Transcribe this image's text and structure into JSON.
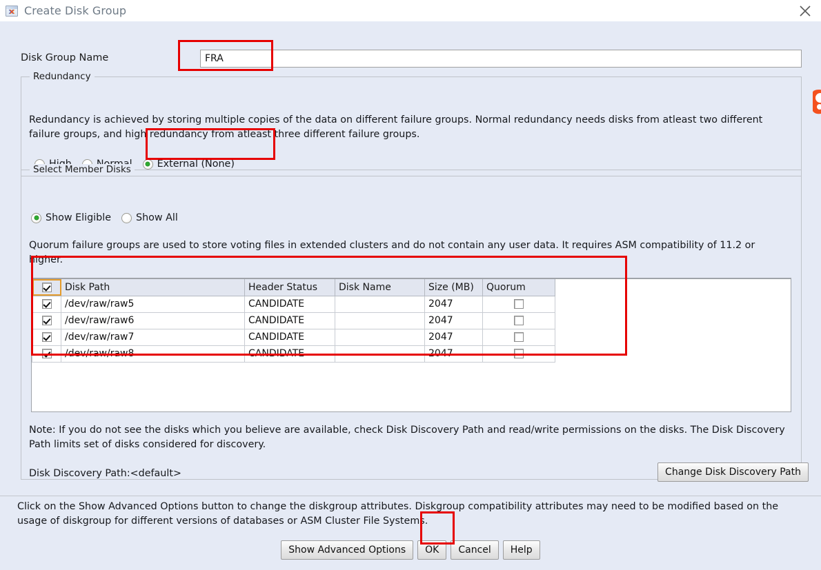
{
  "window": {
    "title": "Create Disk Group",
    "icon": "asm-window-icon",
    "close_label": "close-icon"
  },
  "form": {
    "disk_group_name_label": "Disk Group Name",
    "disk_group_name_value": "FRA",
    "disk_group_name_placeholder": ""
  },
  "redundancy": {
    "legend": "Redundancy",
    "description": "Redundancy is achieved by storing multiple copies of the data on different failure groups. Normal redundancy needs disks from atleast two different failure groups, and high redundancy from atleast three different failure groups.",
    "options": [
      {
        "label": "High",
        "selected": false
      },
      {
        "label": "Normal",
        "selected": false
      },
      {
        "label": "External (None)",
        "selected": true
      }
    ]
  },
  "member_disks": {
    "legend": "Select Member Disks",
    "filter_options": [
      {
        "label": "Show Eligible",
        "selected": true
      },
      {
        "label": "Show All",
        "selected": false
      }
    ],
    "quorum_note": "Quorum failure groups are used to store voting files in extended clusters and do not contain any user data. It requires ASM compatibility of 11.2 or higher.",
    "table": {
      "select_all_checked": true,
      "columns": [
        "Disk Path",
        "Header Status",
        "Disk Name",
        "Size (MB)",
        "Quorum"
      ],
      "rows": [
        {
          "selected": true,
          "path": "/dev/raw/raw5",
          "header_status": "CANDIDATE",
          "disk_name": "",
          "size_mb": "2047",
          "quorum": false
        },
        {
          "selected": true,
          "path": "/dev/raw/raw6",
          "header_status": "CANDIDATE",
          "disk_name": "",
          "size_mb": "2047",
          "quorum": false
        },
        {
          "selected": true,
          "path": "/dev/raw/raw7",
          "header_status": "CANDIDATE",
          "disk_name": "",
          "size_mb": "2047",
          "quorum": false
        },
        {
          "selected": true,
          "path": "/dev/raw/raw8",
          "header_status": "CANDIDATE",
          "disk_name": "",
          "size_mb": "2047",
          "quorum": false
        }
      ]
    },
    "note": "Note: If you do not see the disks which you believe are available, check Disk Discovery Path and read/write permissions on the disks. The Disk Discovery Path limits set of disks considered for discovery.",
    "discovery_path_label": "Disk Discovery Path:<default>",
    "change_discovery_button": "Change Disk Discovery Path"
  },
  "footer": {
    "advanced_note": "Click on the Show Advanced Options button to change the diskgroup attributes. Diskgroup compatibility attributes may need to be modified based on the usage of diskgroup for different versions of databases or ASM Cluster File Systems.",
    "buttons": [
      {
        "label": "Show Advanced Options",
        "name": "show-advanced-options-button"
      },
      {
        "label": "OK",
        "name": "ok-button"
      },
      {
        "label": "Cancel",
        "name": "cancel-button"
      },
      {
        "label": "Help",
        "name": "help-button"
      }
    ]
  },
  "annotations": {
    "color": "#e60000",
    "boxes": [
      "disk-group-name-field",
      "external-none-radio",
      "disk-table",
      "ok-button"
    ]
  },
  "colors": {
    "dialog_background": "#e5eaf5",
    "titlebar_background": "#ffffff",
    "accent_selected_radio": "#2eaa30",
    "table_header": "#e2e6f0",
    "focus_outline": "#e49b2c"
  }
}
